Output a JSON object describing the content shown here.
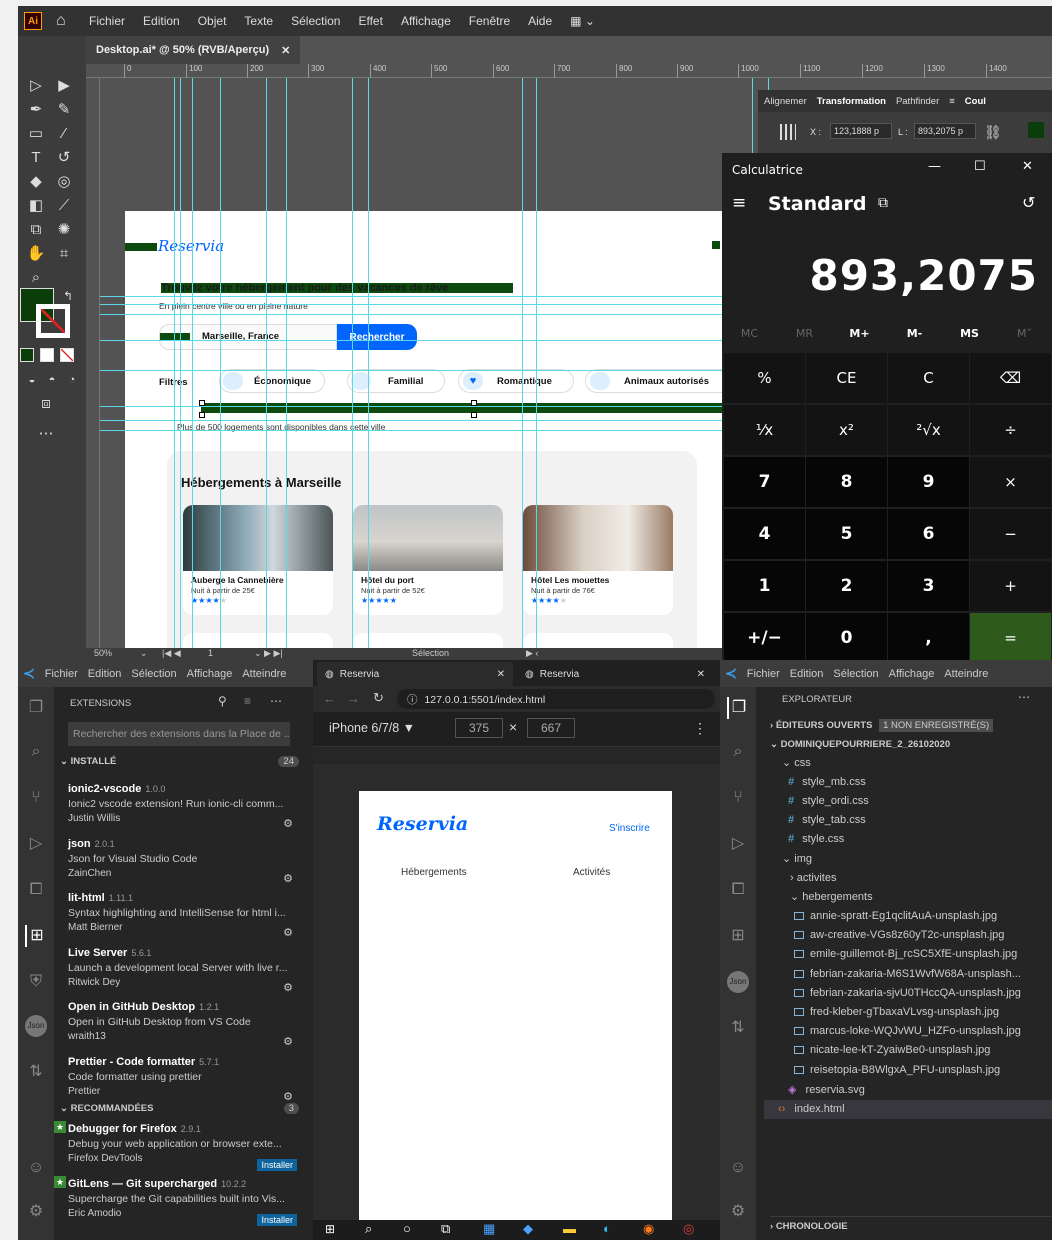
{
  "illustrator": {
    "logo": "Ai",
    "menus": [
      "Fichier",
      "Edition",
      "Objet",
      "Texte",
      "Sélection",
      "Effet",
      "Affichage",
      "Fenêtre",
      "Aide"
    ],
    "doc_tab": "Desktop.ai* @ 50% (RVB/Aperçu)",
    "ruler_ticks": [
      "0",
      "100",
      "200",
      "300",
      "400",
      "500",
      "600",
      "700",
      "800",
      "900",
      "1000",
      "1100",
      "1200",
      "1300",
      "1400"
    ],
    "panel": {
      "tabs": [
        "Alignemer",
        "Transformation",
        "Pathfinder"
      ],
      "x_label": "X :",
      "x_value": "123,1888 p",
      "l_label": "L :",
      "l_value": "893,2075 p",
      "extra": "Coul"
    },
    "status": {
      "zoom": "50%",
      "page": "1",
      "tool": "Sélection"
    },
    "artboard": {
      "logo": "Reservia",
      "headline": "Trouvez votre hébergement pour des vacances de rêve",
      "subline": "En plein centre ville ou en pleine nature",
      "search_value": "Marseille, France",
      "search_button": "Rechercher",
      "filters_label": "Filtres",
      "filters": [
        "Économique",
        "Familial",
        "Romantique",
        "Animaux autorisés"
      ],
      "info": "Plus de 500 logements sont disponibles dans cette ville",
      "section_title": "Hébergements à Marseille",
      "cards": [
        {
          "name": "Auberge la Cannebière",
          "price": "Nuit à partir de 25€",
          "stars": 4
        },
        {
          "name": "Hôtel du port",
          "price": "Nuit à partir de 52€",
          "stars": 5
        },
        {
          "name": "Hôtel Les mouettes",
          "price": "Nuit à partir de 76€",
          "stars": 4
        }
      ]
    }
  },
  "calculator": {
    "title": "Calculatrice",
    "mode": "Standard",
    "display": "893,2075",
    "memory": [
      "MC",
      "MR",
      "M+",
      "M-",
      "MS",
      "M˅"
    ],
    "keys": [
      [
        "%",
        "CE",
        "C",
        "⌫"
      ],
      [
        "¹⁄x",
        "x²",
        "²√x",
        "÷"
      ],
      [
        "7",
        "8",
        "9",
        "×"
      ],
      [
        "4",
        "5",
        "6",
        "−"
      ],
      [
        "1",
        "2",
        "3",
        "+"
      ],
      [
        "+/−",
        "0",
        ",",
        "="
      ]
    ]
  },
  "vscode_left": {
    "menus": [
      "Fichier",
      "Edition",
      "Sélection",
      "Affichage",
      "Atteindre"
    ],
    "panel_title": "EXTENSIONS",
    "search_placeholder": "Rechercher des extensions dans la Place de ...",
    "installed_label": "INSTALLÉ",
    "installed_count": "24",
    "installed": [
      {
        "name": "ionic2-vscode",
        "version": "1.0.0",
        "desc": "Ionic2 vscode extension! Run ionic-cli comm...",
        "author": "Justin Willis"
      },
      {
        "name": "json",
        "version": "2.0.1",
        "desc": "Json for Visual Studio Code",
        "author": "ZainChen"
      },
      {
        "name": "lit-html",
        "version": "1.11.1",
        "desc": "Syntax highlighting and IntelliSense for html i...",
        "author": "Matt Bierner"
      },
      {
        "name": "Live Server",
        "version": "5.6.1",
        "desc": "Launch a development local Server with live r...",
        "author": "Ritwick Dey"
      },
      {
        "name": "Open in GitHub Desktop",
        "version": "1.2.1",
        "desc": "Open in GitHub Desktop from VS Code",
        "author": "wraith13"
      },
      {
        "name": "Prettier - Code formatter",
        "version": "5.7.1",
        "desc": "Code formatter using prettier",
        "author": "Prettier"
      }
    ],
    "recommended_label": "RECOMMANDÉES",
    "recommended_count": "3",
    "recommended": [
      {
        "name": "Debugger for Firefox",
        "version": "2.9.1",
        "desc": "Debug your web application or browser exte...",
        "author": "Firefox DevTools",
        "button": "Installer"
      },
      {
        "name": "GitLens — Git supercharged",
        "version": "10.2.2",
        "desc": "Supercharge the Git capabilities built into Vis...",
        "author": "Eric Amodio",
        "button": "Installer"
      }
    ]
  },
  "browser": {
    "tabs": [
      "Reservia",
      "Reservia"
    ],
    "url": "127.0.0.1:5501/index.html",
    "device": "iPhone 6/7/8 ▼",
    "width": "375",
    "height": "667",
    "times": "×",
    "page": {
      "logo": "Reservia",
      "signup": "S'inscrire",
      "nav": [
        "Hébergements",
        "Activités"
      ]
    }
  },
  "vscode_right": {
    "menus": [
      "Fichier",
      "Edition",
      "Sélection",
      "Affichage",
      "Atteindre"
    ],
    "panel_title": "EXPLORATEUR",
    "open_editors": "ÉDITEURS OUVERTS",
    "unsaved": "1 NON ENREGISTRÉ(S)",
    "project": "DOMINIQUEPOURRIERE_2_26102020",
    "css_folder": "css",
    "css_files": [
      "style_mb.css",
      "style_ordi.css",
      "style_tab.css",
      "style.css"
    ],
    "img_folder": "img",
    "activites": "activites",
    "hebergements": "hebergements",
    "images": [
      "annie-spratt-Eg1qclitAuA-unsplash.jpg",
      "aw-creative-VGs8z60yT2c-unsplash.jpg",
      "emile-guillemot-Bj_rcSC5XfE-unsplash.jpg",
      "febrian-zakaria-M6S1WvfW68A-unsplash...",
      "febrian-zakaria-sjvU0THccQA-unsplash.jpg",
      "fred-kleber-gTbaxaVLvsg-unsplash.jpg",
      "marcus-loke-WQJvWU_HZFo-unsplash.jpg",
      "nicate-lee-kT-ZyaiwBe0-unsplash.jpg",
      "reisetopia-B8WlgxA_PFU-unsplash.jpg"
    ],
    "svg_file": "reservia.svg",
    "index_file": "index.html",
    "timeline": "CHRONOLOGIE"
  }
}
